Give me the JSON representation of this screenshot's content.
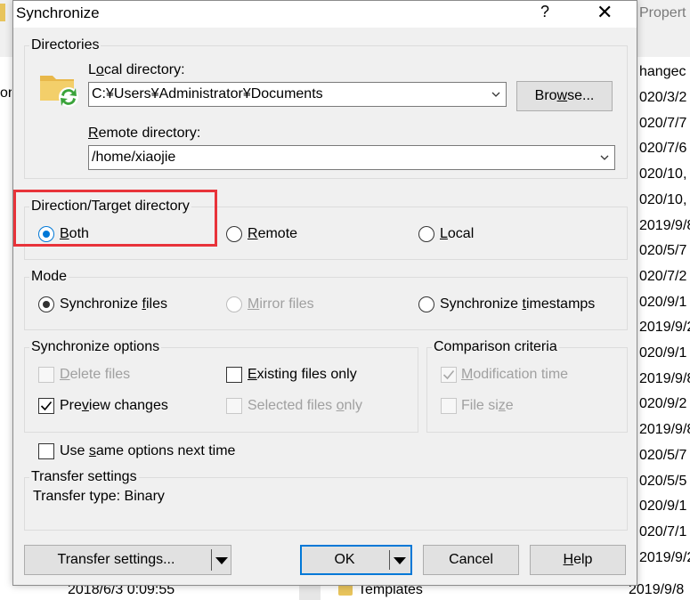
{
  "background": {
    "tab_label": "Propert",
    "column_header": "hangec",
    "left_text": "or",
    "dates": [
      "020/3/2",
      "020/7/7",
      "020/7/6",
      "020/10,",
      "020/10,",
      "2019/9/8",
      "020/5/7",
      "020/7/2",
      "020/9/1",
      "2019/9/2",
      "020/9/1",
      "2019/9/8",
      "020/9/2",
      "2019/9/8",
      "020/5/7",
      "020/5/5",
      "020/9/1",
      "020/7/1",
      "2019/9/2"
    ],
    "bottom_row": {
      "date": "2018/6/3  0:09:55",
      "name": "Templates",
      "date2": "2019/9/8"
    }
  },
  "dialog": {
    "title": "Synchronize",
    "help_label": "?",
    "close_label": "✕",
    "directories": {
      "group_label": "Directories",
      "local_label_pre": "L",
      "local_label_u": "o",
      "local_label_post": "cal directory:",
      "local_value": "C:¥Users¥Administrator¥Documents",
      "browse_pre": "Bro",
      "browse_u": "w",
      "browse_post": "se...",
      "remote_label_pre": "",
      "remote_label_u": "R",
      "remote_label_post": "emote directory:",
      "remote_value": "/home/xiaojie"
    },
    "direction": {
      "group_label": "Direction/Target directory",
      "options": [
        {
          "pre": "",
          "u": "B",
          "post": "oth",
          "checked": true
        },
        {
          "pre": "",
          "u": "R",
          "post": "emote",
          "checked": false
        },
        {
          "pre": "",
          "u": "L",
          "post": "ocal",
          "checked": false
        }
      ]
    },
    "mode": {
      "group_label": "Mode",
      "options": [
        {
          "pre": "Synchronize ",
          "u": "f",
          "post": "iles",
          "checked": true,
          "disabled": false
        },
        {
          "pre": "",
          "u": "M",
          "post": "irror files",
          "checked": false,
          "disabled": true
        },
        {
          "pre": "Synchronize ",
          "u": "t",
          "post": "imestamps",
          "checked": false,
          "disabled": false
        }
      ]
    },
    "sync_options": {
      "group_label": "Synchronize options",
      "items": [
        {
          "pre": "",
          "u": "D",
          "post": "elete files",
          "checked": false,
          "disabled": true
        },
        {
          "pre": "",
          "u": "E",
          "post": "xisting files only",
          "checked": false,
          "disabled": false
        },
        {
          "pre": "Pre",
          "u": "v",
          "post": "iew changes",
          "checked": true,
          "disabled": false
        },
        {
          "pre": "Selected files ",
          "u": "o",
          "post": "nly",
          "checked": false,
          "disabled": true
        }
      ]
    },
    "comparison": {
      "group_label": "Comparison criteria",
      "items": [
        {
          "pre": "",
          "u": "M",
          "post": "odification time",
          "checked": true,
          "disabled": true
        },
        {
          "pre": "File si",
          "u": "z",
          "post": "e",
          "checked": false,
          "disabled": true
        }
      ]
    },
    "same_options": {
      "pre": "Use ",
      "u": "s",
      "post": "ame options next time",
      "checked": false
    },
    "transfer": {
      "group_label": "Transfer settings",
      "text": "Transfer type: Binary"
    },
    "buttons": {
      "transfer_settings": "Transfer settings...",
      "ok": "OK",
      "cancel": "Cancel",
      "help_pre": "",
      "help_u": "H",
      "help_post": "elp"
    },
    "highlight_color": "#e8333a",
    "accent_color": "#0078d7"
  }
}
